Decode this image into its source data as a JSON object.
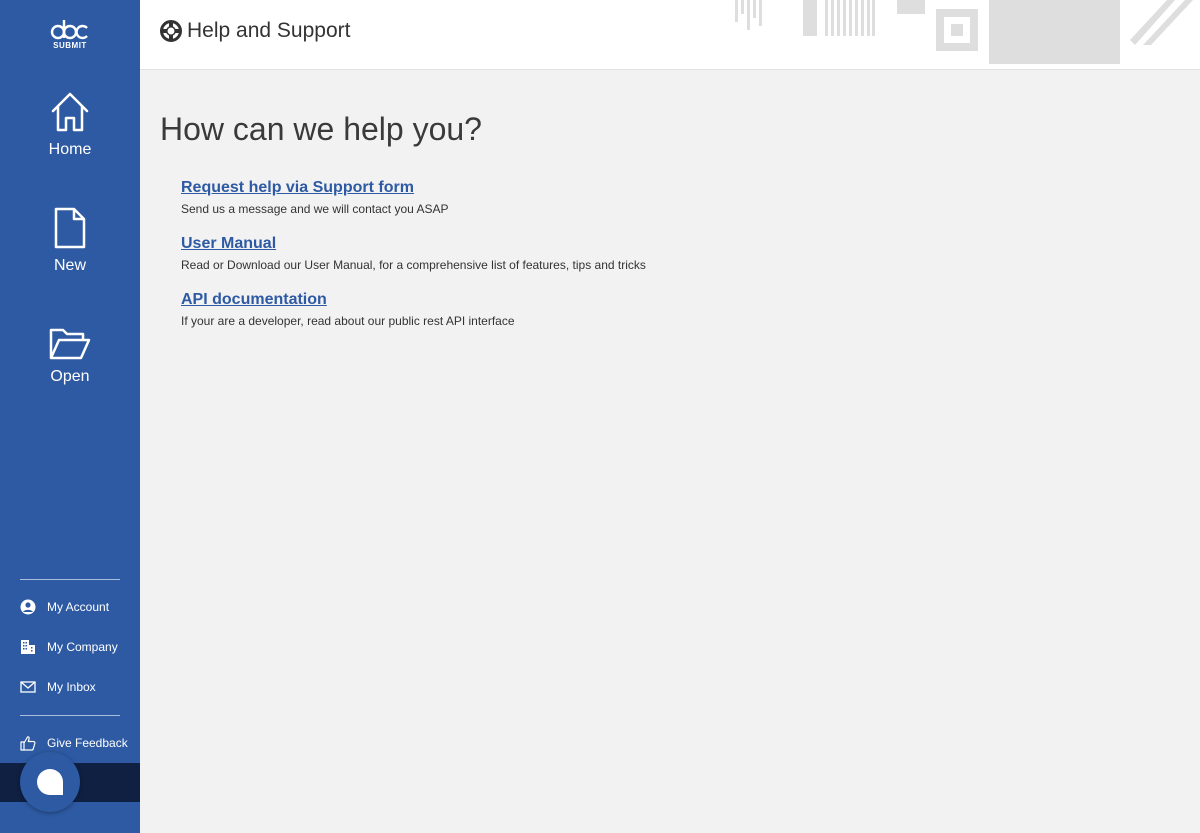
{
  "sidebar": {
    "logo": {
      "text": "SUBMIT"
    },
    "nav": [
      {
        "label": "Home",
        "icon": "home-icon"
      },
      {
        "label": "New",
        "icon": "new-document-icon"
      },
      {
        "label": "Open",
        "icon": "open-folder-icon"
      }
    ],
    "account": [
      {
        "label": "My Account",
        "icon": "user-circle-icon"
      },
      {
        "label": "My Company",
        "icon": "building-icon"
      },
      {
        "label": "My Inbox",
        "icon": "envelope-icon"
      }
    ],
    "feedback": {
      "label": "Give Feedback",
      "icon": "thumbs-up-icon"
    },
    "chat": {
      "icon": "chat-icon"
    }
  },
  "header": {
    "title": "Help and Support",
    "icon": "lifebuoy-icon"
  },
  "main": {
    "heading": "How can we help you?",
    "links": [
      {
        "title": "Request help via Support form",
        "description": "Send us a message and we will contact you ASAP"
      },
      {
        "title": "User Manual",
        "description": "Read or Download our User Manual, for a comprehensive list of features, tips and tricks"
      },
      {
        "title": "API documentation",
        "description": "If your are a developer, read about our public rest API interface"
      }
    ]
  },
  "colors": {
    "sidebar": "#2d5aa3",
    "chat_bar": "#0f2043",
    "link": "#2d5aa3",
    "background": "#f2f2f2"
  }
}
